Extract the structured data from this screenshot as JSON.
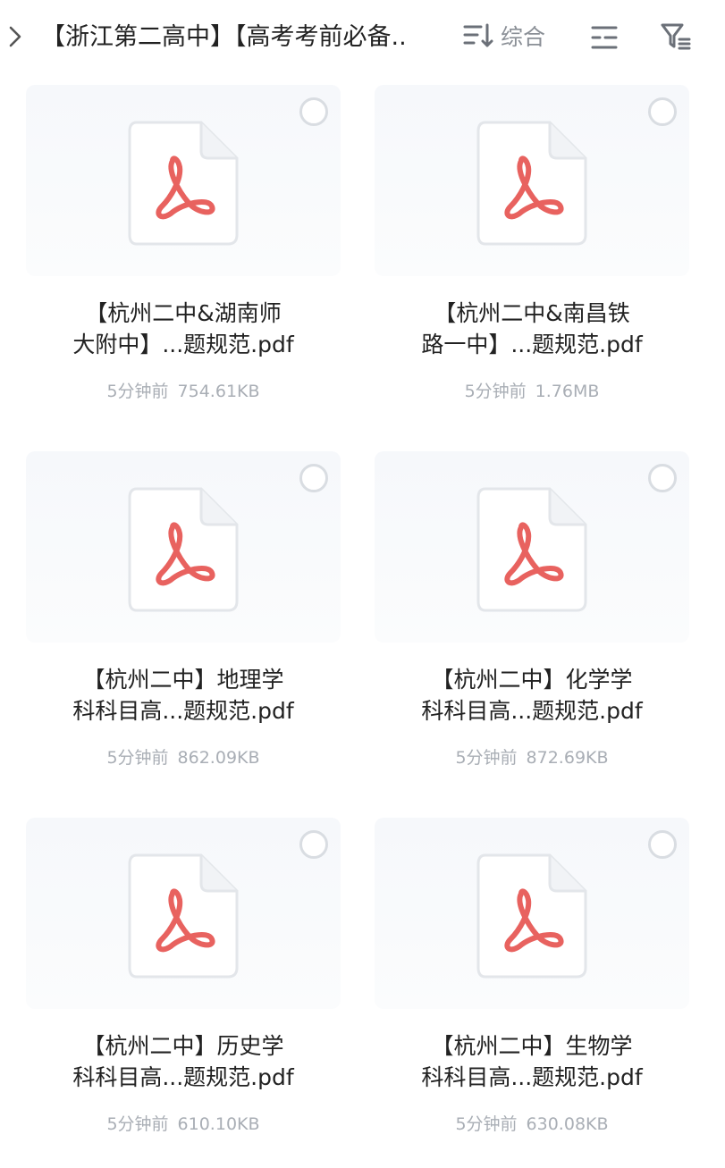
{
  "header": {
    "breadcrumb": "【浙江第二高中】【高考考前必备..",
    "sort_label": "综合",
    "icons": [
      "chevron-right-icon",
      "sort-icon",
      "view-toggle-icon",
      "filter-icon"
    ]
  },
  "files": [
    {
      "name_line1": "【杭州二中&湖南师",
      "name_line2": "大附中】...题规范.pdf",
      "time": "5分钟前",
      "size": "754.61KB",
      "icon": "pdf-icon"
    },
    {
      "name_line1": "【杭州二中&南昌铁",
      "name_line2": "路一中】...题规范.pdf",
      "time": "5分钟前",
      "size": "1.76MB",
      "icon": "pdf-icon"
    },
    {
      "name_line1": "【杭州二中】地理学",
      "name_line2": "科科目高...题规范.pdf",
      "time": "5分钟前",
      "size": "862.09KB",
      "icon": "pdf-icon"
    },
    {
      "name_line1": "【杭州二中】化学学",
      "name_line2": "科科目高...题规范.pdf",
      "time": "5分钟前",
      "size": "872.69KB",
      "icon": "pdf-icon"
    },
    {
      "name_line1": "【杭州二中】历史学",
      "name_line2": "科科目高...题规范.pdf",
      "time": "5分钟前",
      "size": "610.10KB",
      "icon": "pdf-icon"
    },
    {
      "name_line1": "【杭州二中】生物学",
      "name_line2": "科科目高...题规范.pdf",
      "time": "5分钟前",
      "size": "630.08KB",
      "icon": "pdf-icon"
    }
  ],
  "colors": {
    "pdf_red": "#e8625f",
    "meta_gray": "#a9aeb5",
    "checkbox_border": "#d9dde2"
  }
}
